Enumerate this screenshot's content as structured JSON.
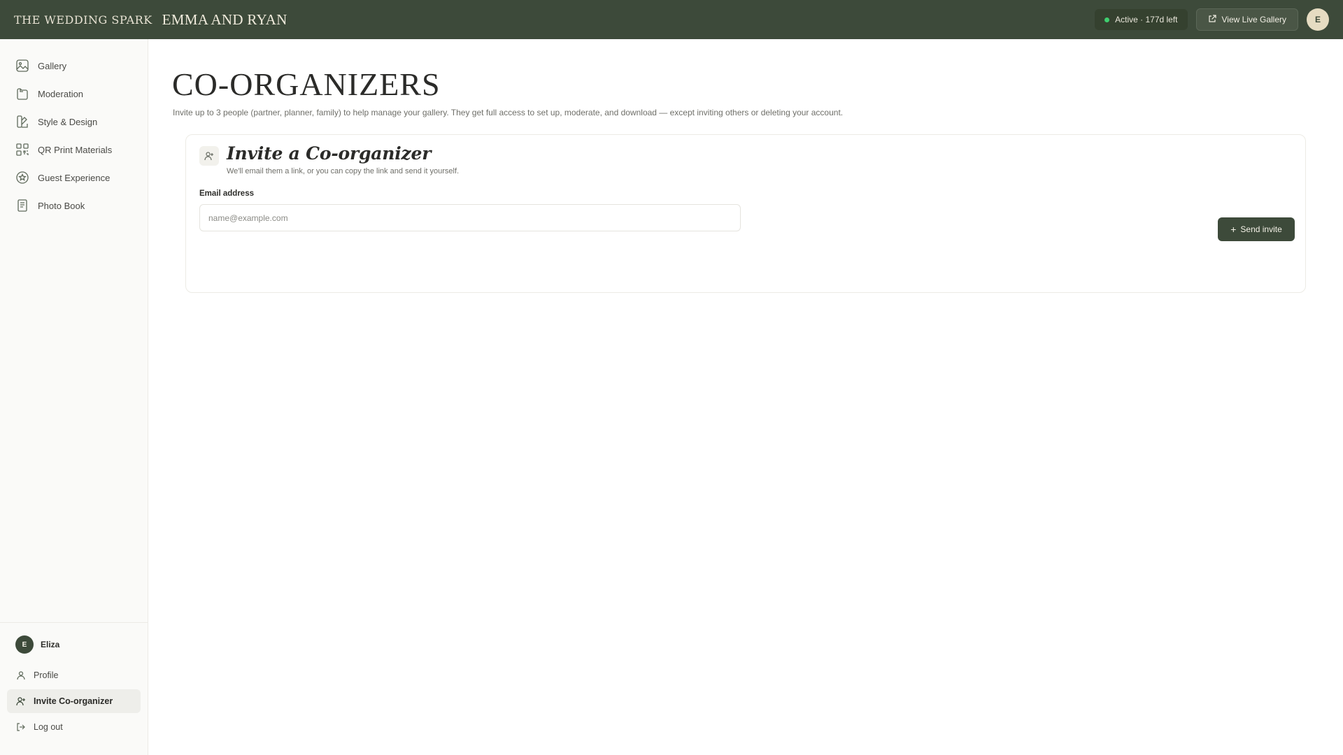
{
  "topbar": {
    "brand": "The Wedding Spark",
    "event_name": "Emma and Ryan",
    "status_text": "Active · 177d left",
    "view_gallery_label": "View Live Gallery",
    "avatar_initial": "E"
  },
  "sidebar": {
    "items": [
      {
        "label": "Gallery",
        "icon": "image-icon"
      },
      {
        "label": "Moderation",
        "icon": "folder-icon"
      },
      {
        "label": "Style & Design",
        "icon": "palette-icon"
      },
      {
        "label": "QR Print Materials",
        "icon": "qr-code-icon"
      },
      {
        "label": "Guest Experience",
        "icon": "star-badge-icon"
      },
      {
        "label": "Photo Book",
        "icon": "book-icon"
      }
    ],
    "user": {
      "initial": "E",
      "name": "Eliza"
    },
    "bottom_items": [
      {
        "label": "Profile",
        "icon": "user-icon"
      },
      {
        "label": "Invite Co-organizer",
        "icon": "user-plus-icon"
      },
      {
        "label": "Log out",
        "icon": "logout-icon"
      }
    ]
  },
  "main": {
    "title": "Co-organizers",
    "description": "Invite up to 3 people (partner, planner, family) to help manage your gallery. They get full access to set up, moderate, and download — except inviting others or deleting your account.",
    "card": {
      "title": "Invite a Co-organizer",
      "subtitle": "We'll email them a link, or you can copy the link and send it yourself.",
      "email_label": "Email address",
      "email_placeholder": "name@example.com",
      "email_value": "",
      "send_label": "Send invite"
    }
  },
  "colors": {
    "header_bg": "#3d4a3a",
    "accent": "#3d4a3a",
    "status_dot": "#3fcf6f"
  }
}
